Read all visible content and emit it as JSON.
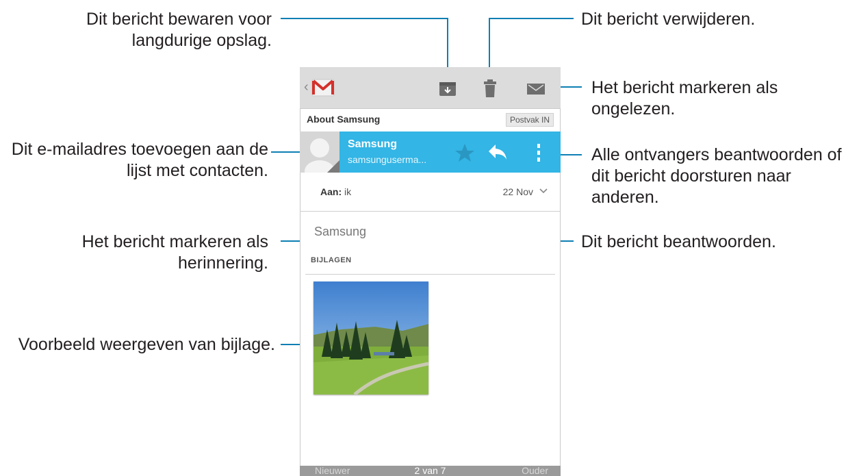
{
  "callouts": {
    "archive": [
      "Dit bericht bewaren voor",
      "langdurige opslag."
    ],
    "delete": [
      "Dit bericht verwijderen."
    ],
    "mark_unread": [
      "Het bericht markeren als",
      "ongelezen."
    ],
    "add_contact": [
      "Dit e-mailadres toevoegen aan de",
      "lijst met contacten."
    ],
    "reply_all_forward": [
      "Alle ontvangers beantwoorden of",
      "dit bericht doorsturen naar",
      "anderen."
    ],
    "star": [
      "Het bericht markeren als",
      "herinnering."
    ],
    "reply": [
      "Dit bericht beantwoorden."
    ],
    "preview_attachment": [
      "Voorbeeld weergeven van bijlage."
    ]
  },
  "email": {
    "subject": "About Samsung",
    "folder": "Postvak IN",
    "sender_name": "Samsung",
    "sender_email": "samsunguserma...",
    "to_label": "Aan:",
    "to_value": "ik",
    "date": "22 Nov",
    "body": "Samsung",
    "attachments_header": "BIJLAGEN"
  },
  "nav": {
    "prev": "Nieuwer",
    "position": "2 van 7",
    "next": "Ouder"
  },
  "colors": {
    "accent": "#33b5e5",
    "actionbar": "#dcdcdc",
    "leader": "#0d7fb3"
  },
  "icons": [
    "gmail-logo-icon",
    "archive-icon",
    "trash-icon",
    "mark-unread-icon",
    "star-icon",
    "reply-icon",
    "overflow-menu-icon",
    "chevron-down-icon"
  ]
}
